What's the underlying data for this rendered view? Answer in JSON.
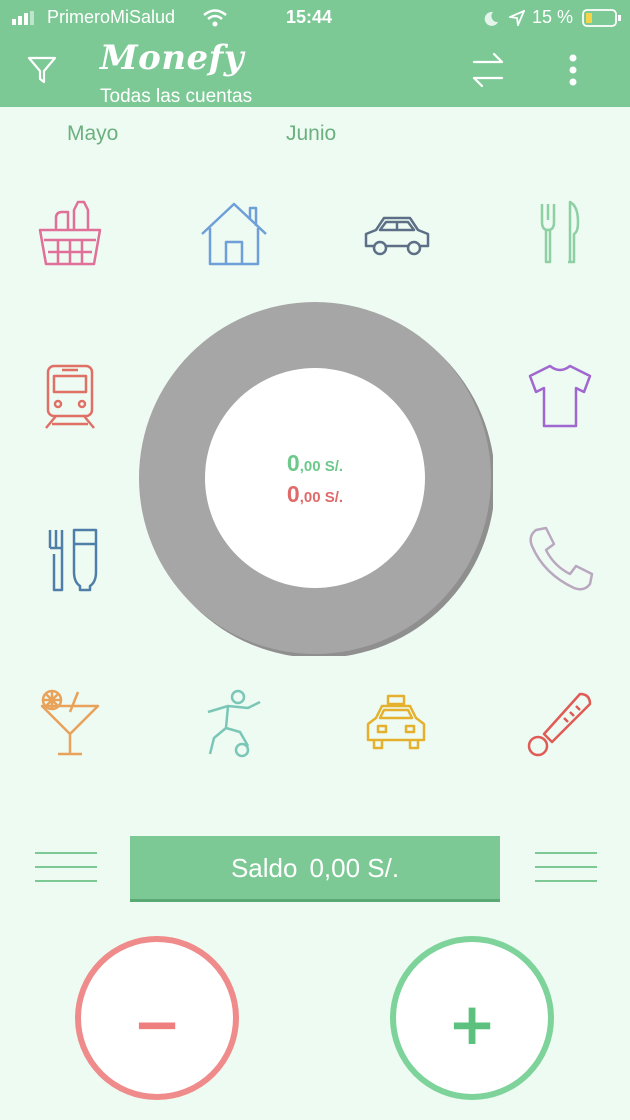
{
  "status_bar": {
    "carrier": "PrimeroMiSalud",
    "time": "15:44",
    "battery": "15 %"
  },
  "app_bar": {
    "title": "Monefy",
    "subtitle": "Todas las cuentas",
    "icons": [
      "filter-icon",
      "transfer-icon",
      "more-vert-icon"
    ]
  },
  "months": {
    "previous": "Mayo",
    "current": "Junio"
  },
  "categories": [
    {
      "name": "groceries",
      "icon": "shopping-basket-icon",
      "color": "#e07098"
    },
    {
      "name": "house",
      "icon": "house-icon",
      "color": "#6f9fd8"
    },
    {
      "name": "car",
      "icon": "car-icon",
      "color": "#5d6f86"
    },
    {
      "name": "eating-out",
      "icon": "fork-knife-icon",
      "color": "#8ecfa4"
    },
    {
      "name": "transport",
      "icon": "train-icon",
      "color": "#e07066"
    },
    {
      "name": "clothes",
      "icon": "tshirt-icon",
      "color": "#a067d0"
    },
    {
      "name": "toiletry",
      "icon": "toothbrush-icon",
      "color": "#4f7fa8"
    },
    {
      "name": "communications",
      "icon": "phone-icon",
      "color": "#b9a8bf"
    },
    {
      "name": "entertainment",
      "icon": "cocktail-icon",
      "color": "#e8a25a"
    },
    {
      "name": "sports",
      "icon": "football-player-icon",
      "color": "#7ac7b7"
    },
    {
      "name": "taxi",
      "icon": "taxi-icon",
      "color": "#e5b02d"
    },
    {
      "name": "health",
      "icon": "thermometer-icon",
      "color": "#e05b55"
    }
  ],
  "summary": {
    "income_int": "0",
    "income_rest": ",00 S/.",
    "expense_int": "0",
    "expense_rest": ",00 S/."
  },
  "balance": {
    "label": "Saldo",
    "value": "0,00 S/."
  },
  "actions": {
    "expense_symbol": "−",
    "income_symbol": "+"
  },
  "colors": {
    "primary": "#7dc996",
    "background": "#eefbf2",
    "donut": "#a6a6a6",
    "income": "#6cc98a",
    "expense": "#e06a6a"
  }
}
